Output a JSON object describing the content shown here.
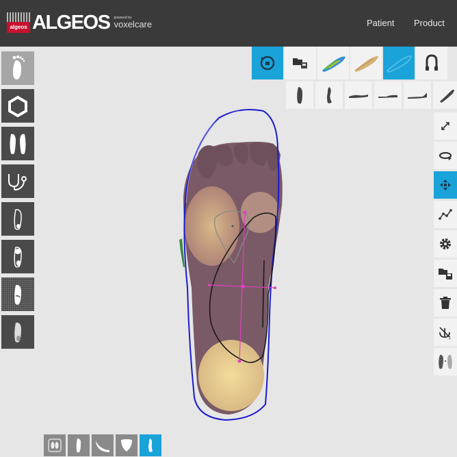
{
  "header": {
    "logo_mark_text": "algeos",
    "logo_text": "ALGEOS",
    "powered_by": "powered by",
    "brand": "voxelcare",
    "nav": {
      "patient": "Patient",
      "product": "Product"
    }
  },
  "left_toolbar": {
    "items": [
      "foot-scan-icon",
      "hexagon-icon",
      "feet-pair-icon",
      "stethoscope-icon",
      "foot-outline-icon",
      "foot-pressure-icon",
      "foot-insole-icon",
      "foot-sole-icon"
    ],
    "active_index": 0
  },
  "top_toolbar": {
    "items": [
      "rotate-view-icon",
      "folder-image-icon",
      "insole-colored-icon",
      "insole-tan-icon",
      "insole-blue-icon",
      "magnet-icon"
    ],
    "active_indexes": [
      0,
      4
    ]
  },
  "view_toolbar": {
    "items": [
      "view-top-icon",
      "view-side-icon",
      "view-flat-icon",
      "view-low-icon",
      "view-heel-icon",
      "view-angle-icon"
    ]
  },
  "right_toolbar": {
    "items": [
      "expand-icon",
      "rotate-icon",
      "move-icon",
      "graph-icon",
      "gear-icon",
      "folder-save-icon",
      "trash-icon",
      "anchor-icon",
      "feet-compare-icon"
    ],
    "active_index": 2
  },
  "bottom_toolbar": {
    "items": [
      "footprints-icon",
      "foot-narrow-icon",
      "arch-icon",
      "heel-cup-icon",
      "foot-blue-icon"
    ],
    "active_index": 4
  },
  "colors": {
    "header_bg": "#3a3a3a",
    "accent_blue": "#1aa3d9",
    "dark_button": "#4a4a4a",
    "outline_blue": "#1a1acd",
    "guide_magenta": "#e040c0"
  }
}
